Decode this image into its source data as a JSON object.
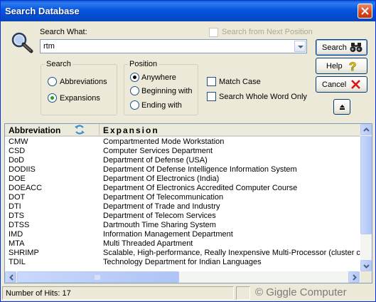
{
  "window": {
    "title": "Search Database"
  },
  "search": {
    "label": "Search What:",
    "value": "rtm",
    "from_next_label": "Search from Next Position",
    "from_next_checked": false
  },
  "search_group": {
    "label": "Search",
    "options": [
      "Abbreviations",
      "Expansions"
    ],
    "selected": "Expansions"
  },
  "position_group": {
    "label": "Position",
    "options": [
      "Anywhere",
      "Beginning with",
      "Ending with"
    ],
    "selected": "Anywhere"
  },
  "options": {
    "match_case_label": "Match Case",
    "match_case_checked": false,
    "whole_word_label": "Search Whole Word Only",
    "whole_word_checked": false
  },
  "buttons": {
    "search": "Search",
    "help": "Help",
    "cancel": "Cancel"
  },
  "list": {
    "columns": [
      "Abbreviation",
      "Expansion"
    ],
    "rows": [
      [
        "CMW",
        "Compartmented Mode Workstation"
      ],
      [
        "CSD",
        "Computer Services Department"
      ],
      [
        "DoD",
        "Department of Defense (USA)"
      ],
      [
        "DODIIS",
        "Department Of Defense Intelligence Information System"
      ],
      [
        "DOE",
        "Department Of Electronics (India)"
      ],
      [
        "DOEACC",
        "Department Of Electronics Accredited Computer Course"
      ],
      [
        "DOT",
        "Department Of Telecommunication"
      ],
      [
        "DTI",
        "Department of Trade and Industry"
      ],
      [
        "DTS",
        "Department of Telecom Services"
      ],
      [
        "DTSS",
        "Dartmouth Time Sharing System"
      ],
      [
        "IMD",
        "Information Management Department"
      ],
      [
        "MTA",
        "Multi Threaded Apartment"
      ],
      [
        "SHRIMP",
        "Scalable, High-performance, Really Inexpensive Multi-Processor (cluster cc"
      ],
      [
        "TDIL",
        "Technology Department for Indian Languages"
      ]
    ]
  },
  "status": {
    "hits": "Number of Hits: 17",
    "copyright": "© Giggle Computer"
  },
  "colors": {
    "titlebar": "#0755e0",
    "face": "#ece9d8",
    "accent_green": "#21a121"
  },
  "icons": [
    "magnifier-icon",
    "binoculars-icon",
    "help-question-icon",
    "cancel-x-icon",
    "collapse-up-icon",
    "sort-icon",
    "close-icon"
  ]
}
